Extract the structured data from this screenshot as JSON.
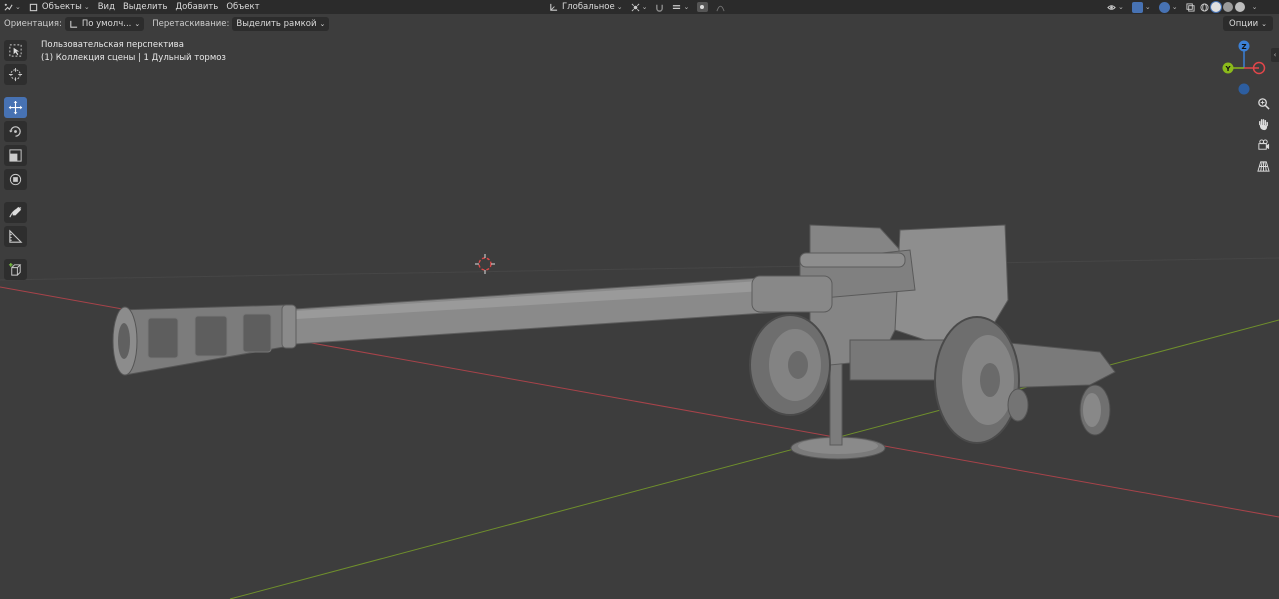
{
  "header": {
    "mode_label": "Объекты",
    "menu": [
      "Вид",
      "Выделить",
      "Добавить",
      "Объект"
    ],
    "transform_orientation": "Глобальное"
  },
  "tool_settings": {
    "orientation_label": "Ориентация:",
    "orientation_value": "По умолч...",
    "drag_label": "Перетаскивание:",
    "drag_value": "Выделить рамкой",
    "options_label": "Опции"
  },
  "viewport": {
    "view_name": "Пользовательская перспектива",
    "collection_info": "(1) Коллекция сцены | 1 Дульный тормоз"
  },
  "gizmo": {
    "z_label": "Z",
    "y_label": "Y",
    "colors": {
      "x": "#e2464a",
      "y": "#8bba1b",
      "z": "#3b80d6",
      "neg": "#2d5ea0"
    }
  },
  "toolbar": {
    "tools": [
      "select-box",
      "cursor",
      "move",
      "rotate",
      "scale",
      "transform",
      "annotate",
      "measure",
      "add-cube"
    ],
    "active": "move"
  },
  "nav_icons": [
    "zoom-icon",
    "hand-pan-icon",
    "camera-icon",
    "grid-icon"
  ],
  "colors": {
    "background": "#3d3d3d",
    "header": "#2b2b2b",
    "accent": "#4772b3",
    "x_axis": "#a8434a",
    "y_axis": "#6f8f2c"
  }
}
